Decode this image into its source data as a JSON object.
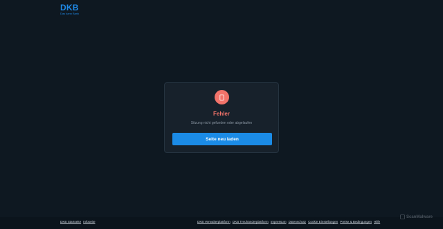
{
  "logo": {
    "mark": "DKB",
    "tagline": "Das kann Bank"
  },
  "error_card": {
    "title": "Fehler",
    "message": "Sitzung nicht gefunden oder abgelaufen",
    "reload_label": "Seite neu laden"
  },
  "footer": {
    "left_links": [
      "DKB Startseite",
      "Infoseite"
    ],
    "right_links": [
      "DKB Verwalterplattform",
      "DKB Treuhänderplattform",
      "Impressum",
      "Datenschutz",
      "Cookie Einstellungen",
      "Preise & Bedingungen",
      "Hilfe"
    ]
  },
  "watermark": {
    "text": "ScanMalware"
  },
  "colors": {
    "background": "#0e1821",
    "brand": "#1f8ae8",
    "error": "#f2736a",
    "button": "#1b8be6"
  }
}
